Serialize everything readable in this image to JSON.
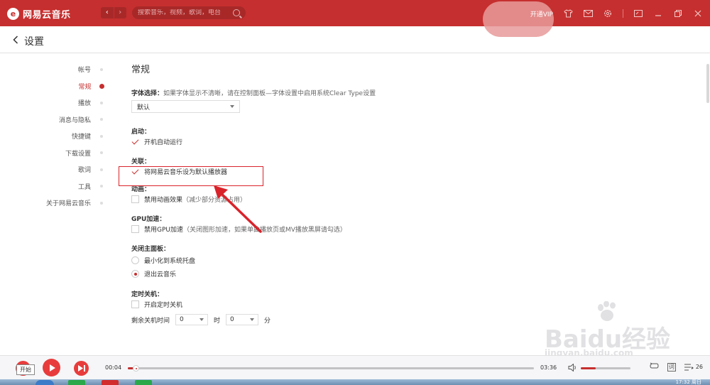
{
  "titlebar": {
    "app_name": "网易云音乐",
    "logo_glyph": "e",
    "nav_back": "‹",
    "nav_forward": "›",
    "search_placeholder": "搜索音乐，视频，歌词，电台",
    "vip_label": "开通VIP",
    "icons": [
      "shirt-icon",
      "mail-icon",
      "gear-icon",
      "mini-mode-icon",
      "minimize-icon",
      "maximize-icon",
      "close-icon"
    ],
    "accent_color": "#c62f2f"
  },
  "page": {
    "back_label": "设置"
  },
  "leftnav": {
    "items": [
      {
        "label": "帐号",
        "active": false
      },
      {
        "label": "常规",
        "active": true
      },
      {
        "label": "播放",
        "active": false
      },
      {
        "label": "消息与隐私",
        "active": false
      },
      {
        "label": "快捷键",
        "active": false
      },
      {
        "label": "下载设置",
        "active": false
      },
      {
        "label": "歌词",
        "active": false
      },
      {
        "label": "工具",
        "active": false
      },
      {
        "label": "关于网易云音乐",
        "active": false
      }
    ]
  },
  "general": {
    "title": "常规",
    "font": {
      "label": "字体选择：",
      "hint": "如果字体显示不清晰，请在控制面板—字体设置中启用系统Clear Type设置",
      "value": "默认"
    },
    "startup": {
      "label": "启动：",
      "option": "开机自动运行",
      "checked": true
    },
    "association": {
      "label": "关联：",
      "option": "将网易云音乐设为默认播放器",
      "checked": true
    },
    "animation": {
      "label": "动画：",
      "option": "禁用动画效果",
      "hint": "（减少部分资源占用）",
      "checked": false
    },
    "gpu": {
      "label": "GPU加速：",
      "option": "禁用GPU加速",
      "hint": "（关闭图形加速，如果单曲播放页或MV播放黑屏请勾选）",
      "checked": false
    },
    "close_panel": {
      "label": "关闭主面板：",
      "options": [
        {
          "label": "最小化到系统托盘",
          "selected": false
        },
        {
          "label": "退出云音乐",
          "selected": true
        }
      ]
    },
    "shutdown": {
      "label": "定时关机：",
      "option": "开启定时关机",
      "checked": false,
      "remaining_label": "剩余关机时间",
      "hours_value": "0",
      "hours_unit": "时",
      "minutes_value": "0",
      "minutes_unit": "分"
    }
  },
  "player": {
    "tooltip": "开始",
    "current_time": "00:04",
    "total_time": "03:36",
    "progress": 0.02,
    "volume": 0.3,
    "lyrics_label": "词",
    "playlist_count": "26"
  },
  "watermark": {
    "main": "Baidu经验",
    "url": "jingyan.baidu.com"
  },
  "taskbar": {
    "clock": "17:32 周日"
  }
}
